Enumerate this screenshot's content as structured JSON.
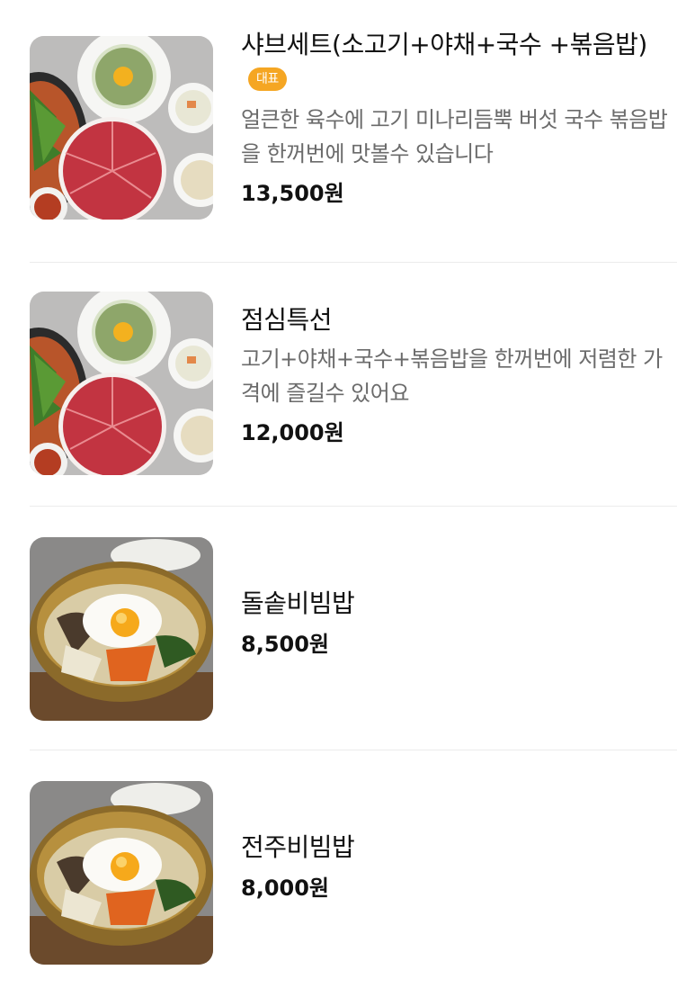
{
  "menu": {
    "items": [
      {
        "name": "샤브세트(소고기+야채+국수 +볶음밥)",
        "badge": "대표",
        "description": "얼큰한 육수에 고기 미나리듬뿍 버섯 국수 볶음밥을 한꺼번에 맛볼수 있습니다",
        "price": "13,500원",
        "image": "shabu-set-photo"
      },
      {
        "name": "점심특선",
        "description": "고기+야채+국수+볶음밥을 한꺼번에 저렴한 가격에 즐길수 있어요",
        "price": "12,000원",
        "image": "shabu-set-photo"
      },
      {
        "name": "돌솥비빔밥",
        "price": "8,500원",
        "image": "bibimbap-photo"
      },
      {
        "name": "전주비빔밥",
        "price": "8,000원",
        "image": "bibimbap-photo"
      }
    ]
  },
  "colors": {
    "badge": "#f5a623",
    "description": "#6b6b6b",
    "divider": "#ececec"
  }
}
